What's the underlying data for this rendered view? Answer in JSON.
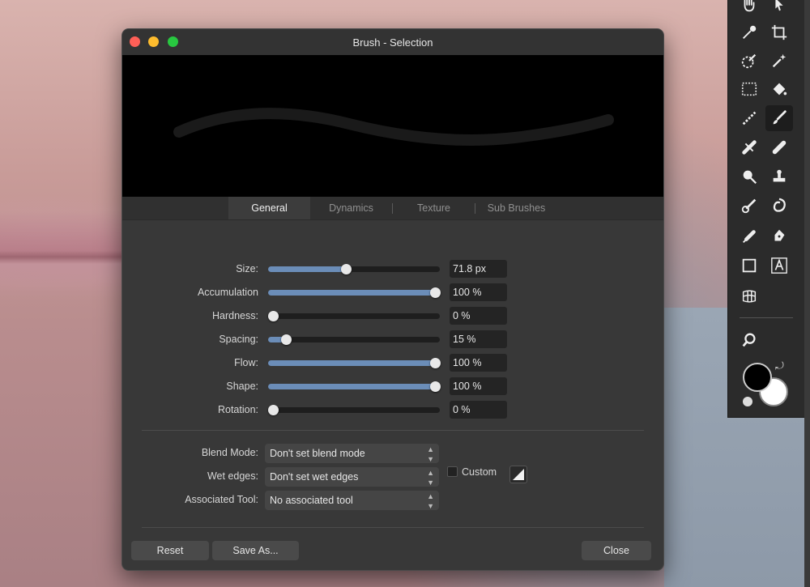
{
  "dialog": {
    "title": "Brush - Selection",
    "tabs": [
      {
        "label": "General",
        "active": true
      },
      {
        "label": "Dynamics",
        "active": false
      },
      {
        "label": "Texture",
        "active": false
      },
      {
        "label": "Sub Brushes",
        "active": false
      }
    ],
    "sliders": [
      {
        "label": "Size:",
        "value": "71.8 px",
        "level": 0.45
      },
      {
        "label": "Accumulation",
        "value": "100 %",
        "level": 1.0
      },
      {
        "label": "Hardness:",
        "value": "0 %",
        "level": 0.0
      },
      {
        "label": "Spacing:",
        "value": "15 %",
        "level": 0.08
      },
      {
        "label": "Flow:",
        "value": "100 %",
        "level": 1.0
      },
      {
        "label": "Shape:",
        "value": "100 %",
        "level": 1.0
      },
      {
        "label": "Rotation:",
        "value": "0 %",
        "level": 0.0
      }
    ],
    "selects": [
      {
        "label": "Blend Mode:",
        "value": "Don't set blend mode"
      },
      {
        "label": "Wet edges:",
        "value": "Don't set wet edges"
      },
      {
        "label": "Associated Tool:",
        "value": "No associated tool"
      }
    ],
    "custom_label": "Custom",
    "buttons": {
      "reset": "Reset",
      "save_as": "Save As...",
      "close": "Close"
    }
  },
  "colors": {
    "accent": "#6b8db8",
    "close": "#fe5f57",
    "minimize": "#febc2e",
    "maximize": "#28c840"
  },
  "tools": [
    "hand-icon",
    "move-icon",
    "color-picker-icon",
    "crop-icon",
    "selection-brush-icon",
    "magic-wand-icon",
    "marquee-icon",
    "flood-fill-icon",
    "gradient-icon",
    "paint-brush-icon",
    "healing-icon",
    "patch-icon",
    "dodge-icon",
    "clone-stamp-icon",
    "smudge-icon",
    "liquify-icon",
    "erase-brush-icon",
    "pen-icon",
    "rectangle-icon",
    "text-icon",
    "mesh-warp-icon",
    "zoom-icon"
  ]
}
